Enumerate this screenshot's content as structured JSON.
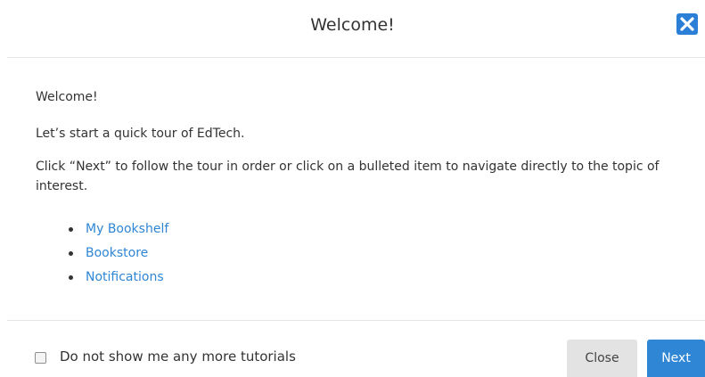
{
  "modal": {
    "title": "Welcome!",
    "close_icon": "close-x-icon",
    "accent_color": "#2f86d4"
  },
  "body": {
    "greeting": "Welcome!",
    "intro": "Let’s start a quick tour of EdTech.",
    "instructions": "Click “Next” to follow the tour in order or click on a bulleted item to navigate directly to the topic of interest.",
    "topics": [
      {
        "label": "My Bookshelf"
      },
      {
        "label": "Bookstore"
      },
      {
        "label": "Notifications"
      }
    ]
  },
  "footer": {
    "checkbox_label": "Do not show me any more tutorials",
    "checkbox_checked": false,
    "close_label": "Close",
    "next_label": "Next"
  }
}
